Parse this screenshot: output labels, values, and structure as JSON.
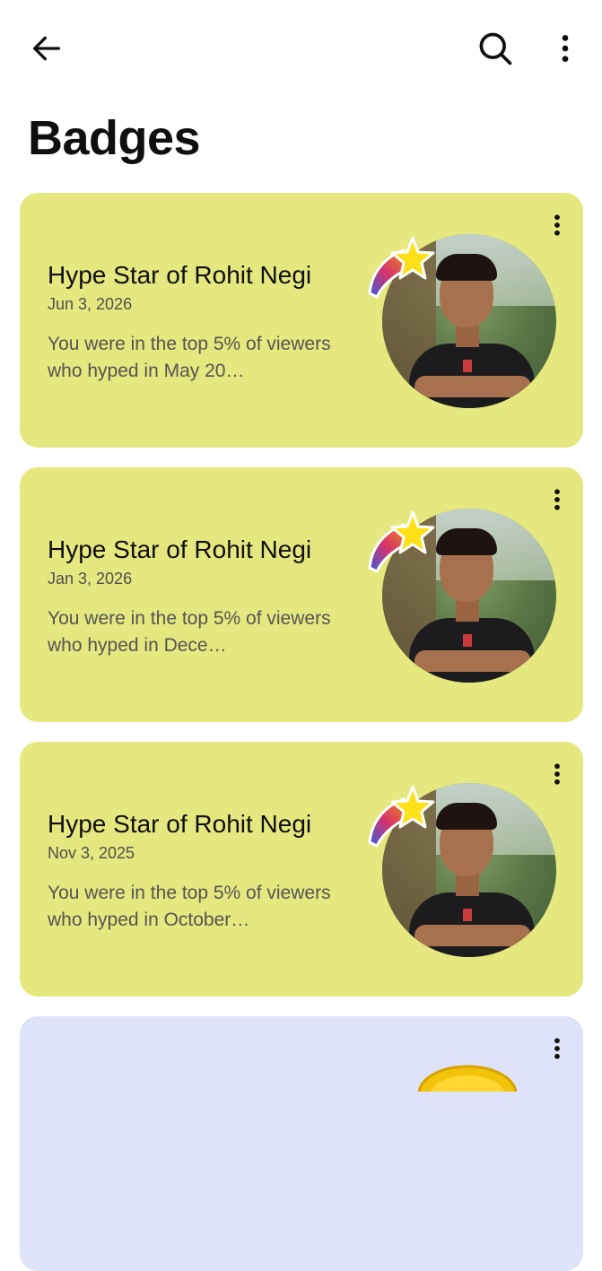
{
  "header": {
    "back_icon": "arrow-left-icon",
    "search_icon": "search-icon",
    "more_icon": "more-vert-icon"
  },
  "page": {
    "title": "Badges"
  },
  "badges": [
    {
      "title": "Hype Star of Rohit Negi",
      "date": "Jun 3, 2026",
      "description": "You were in the top 5% of viewers who hyped in May 20…",
      "color": "#e4e87e"
    },
    {
      "title": "Hype Star of Rohit Negi",
      "date": "Jan 3, 2026",
      "description": "You were in the top 5% of viewers who hyped in Dece…",
      "color": "#e4e87e"
    },
    {
      "title": "Hype Star of Rohit Negi",
      "date": "Nov 3, 2025",
      "description": "You were in the top 5% of viewers who hyped in October…",
      "color": "#e4e87e"
    }
  ],
  "partial_card": {
    "color": "#dfe3fa"
  }
}
